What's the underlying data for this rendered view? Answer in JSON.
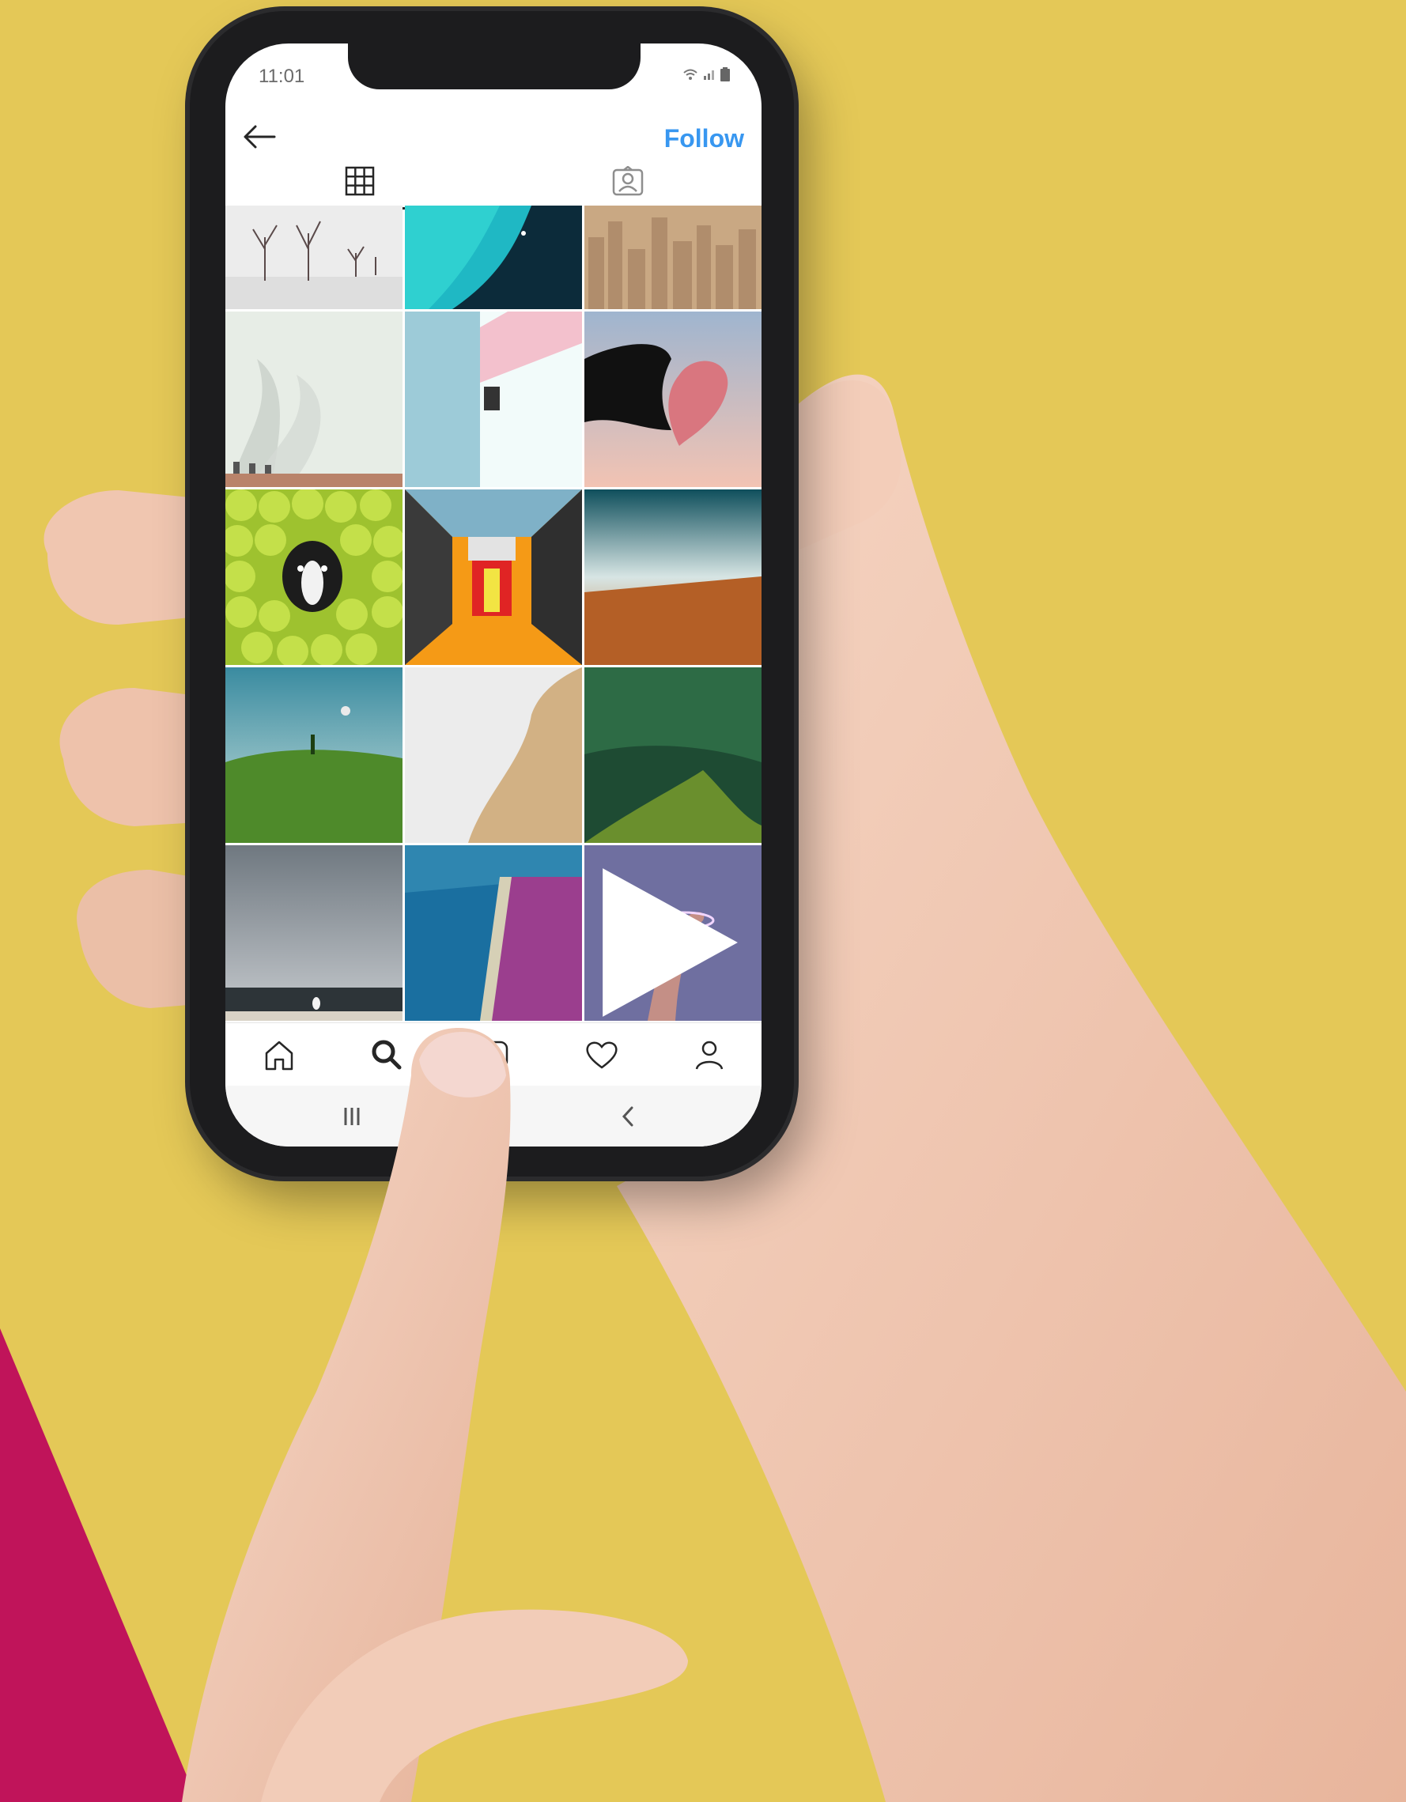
{
  "colors": {
    "background": "#e4c857",
    "accent_wedge": "#c0145a",
    "follow_blue": "#3897f0",
    "skin": "#f0c9b3"
  },
  "status_bar": {
    "time": "11:01",
    "icons": [
      "wifi-icon",
      "signal-icon",
      "battery-icon"
    ]
  },
  "header": {
    "back_icon": "back-arrow-icon",
    "follow_label": "Follow"
  },
  "tabs": [
    {
      "name": "grid",
      "icon": "grid-icon",
      "active": true
    },
    {
      "name": "tagged",
      "icon": "tagged-photos-icon",
      "active": false
    }
  ],
  "grid": {
    "columns": 3,
    "tiles": [
      {
        "subject": "snowy-trees",
        "video": false
      },
      {
        "subject": "turquoise-sea",
        "video": false
      },
      {
        "subject": "city-skyline",
        "video": false
      },
      {
        "subject": "smoking-chimneys",
        "video": false
      },
      {
        "subject": "pastel-architecture",
        "video": false
      },
      {
        "subject": "hand-heart-cloud",
        "video": false
      },
      {
        "subject": "dog-tennis-balls",
        "video": false
      },
      {
        "subject": "colorful-staircase",
        "video": false
      },
      {
        "subject": "motion-road",
        "video": false
      },
      {
        "subject": "green-hill-tree",
        "video": false
      },
      {
        "subject": "beach-aerial",
        "video": false
      },
      {
        "subject": "green-ridges",
        "video": false
      },
      {
        "subject": "grey-sea-seagull",
        "video": false
      },
      {
        "subject": "blue-pink-lake",
        "video": false
      },
      {
        "subject": "hand-neon-ring",
        "video": true
      }
    ]
  },
  "bottom_nav": [
    {
      "name": "home",
      "icon": "home-icon"
    },
    {
      "name": "search",
      "icon": "search-icon",
      "active": true
    },
    {
      "name": "new-post",
      "icon": "add-post-icon"
    },
    {
      "name": "activity",
      "icon": "heart-icon"
    },
    {
      "name": "profile",
      "icon": "profile-icon"
    }
  ],
  "system_nav": [
    "recent-apps-icon",
    "home-button",
    "back-chevron-icon"
  ]
}
